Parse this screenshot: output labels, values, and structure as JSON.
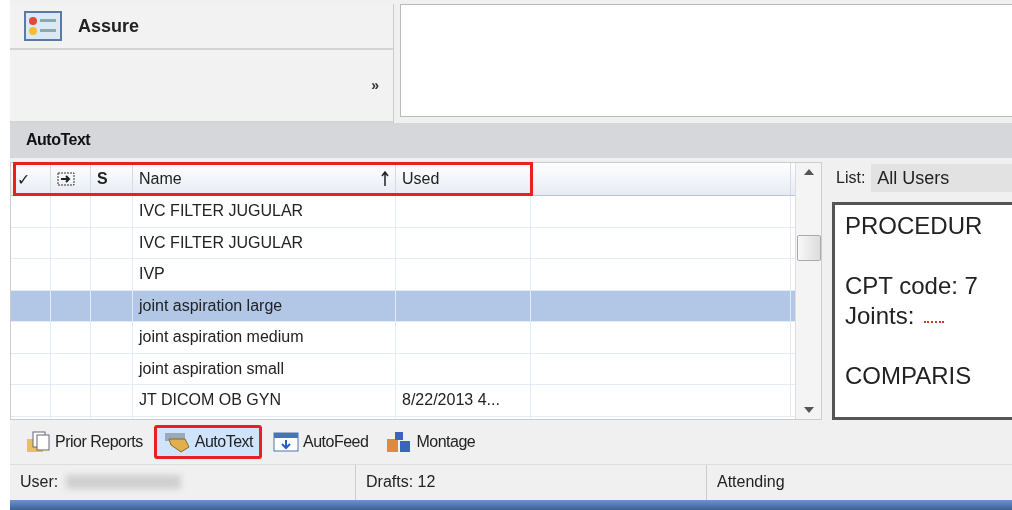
{
  "top_pane": {
    "title": "Assure",
    "overflow": "»"
  },
  "section": {
    "title": "AutoText"
  },
  "table": {
    "highlighted": true,
    "columns": [
      {
        "kind": "text",
        "label": "✓",
        "sorted": false
      },
      {
        "kind": "icon",
        "sorted": false
      },
      {
        "kind": "text",
        "label": "S",
        "sorted": false
      },
      {
        "kind": "text",
        "label": "Name",
        "sorted": true
      },
      {
        "kind": "text",
        "label": "Used",
        "sorted": false
      }
    ],
    "rows": [
      {
        "name": "IVC FILTER JUGULAR",
        "used": "",
        "selected": false
      },
      {
        "name": "IVC FILTER JUGULAR",
        "used": "",
        "selected": false
      },
      {
        "name": "IVP",
        "used": "",
        "selected": false
      },
      {
        "name": "joint aspiration large",
        "used": "",
        "selected": true
      },
      {
        "name": "joint aspiration medium",
        "used": "",
        "selected": false
      },
      {
        "name": "joint aspiration small",
        "used": "",
        "selected": false
      },
      {
        "name": "JT DICOM OB GYN",
        "used": "8/22/2013 4...",
        "selected": false
      }
    ]
  },
  "side": {
    "list_label": "List:",
    "list_value": "All Users",
    "preview": [
      {
        "kind": "line",
        "text": "PROCEDUR"
      },
      {
        "kind": "blank"
      },
      {
        "kind": "line",
        "text": "CPT code: 7"
      },
      {
        "kind": "field",
        "text": "Joints:"
      },
      {
        "kind": "blank"
      },
      {
        "kind": "line",
        "text": "COMPARIS"
      }
    ]
  },
  "tabs": [
    {
      "label": "Prior Reports",
      "kind": "reports",
      "selected": false,
      "highlighted": false
    },
    {
      "label": "AutoText",
      "kind": "autotext",
      "selected": true,
      "highlighted": true
    },
    {
      "label": "AutoFeed",
      "kind": "autofeed",
      "selected": false,
      "highlighted": false
    },
    {
      "label": "Montage",
      "kind": "montage",
      "selected": false,
      "highlighted": false
    }
  ],
  "status_bar": [
    {
      "kind": "redacted",
      "label": "User:"
    },
    {
      "kind": "text",
      "label": "Drafts: 12"
    },
    {
      "kind": "text",
      "label": "Attending"
    }
  ]
}
